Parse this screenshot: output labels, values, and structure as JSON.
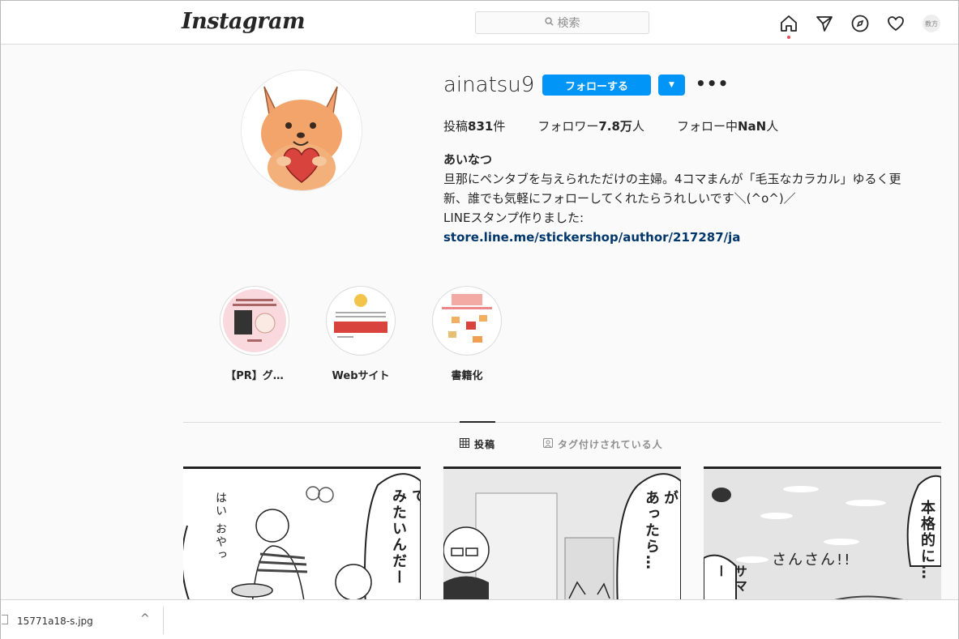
{
  "nav": {
    "logo": "Instagram",
    "search_placeholder": "検索",
    "avatar_text": "教方"
  },
  "profile": {
    "username": "ainatsu9",
    "follow_label": "フォローする",
    "more_label": "•••",
    "stats": {
      "posts_label": "投稿",
      "posts_value": "831",
      "posts_suffix": "件",
      "followers_label": "フォロワー",
      "followers_value": "7.8万",
      "followers_suffix": "人",
      "following_label": "フォロー中",
      "following_value": "NaN",
      "following_suffix": "人"
    },
    "display_name": "あいなつ",
    "bio_line1": "旦那にペンタブを与えられただけの主婦。4コマまんが「毛玉なカラカル」ゆるく更",
    "bio_line2": "新、誰でも気軽にフォローしてくれたらうれしいです＼(^o^)／",
    "bio_line3": "LINEスタンプ作りました:",
    "bio_link": "store.line.me/stickershop/author/217287/ja"
  },
  "highlights": [
    {
      "label": "【PR】グ…"
    },
    {
      "label": "Webサイト"
    },
    {
      "label": "書籍化"
    }
  ],
  "tabs": {
    "posts": "投稿",
    "tagged": "タグ付けされている人"
  },
  "posts": [
    {
      "text_a": "アルプスに行って",
      "text_b": "みたいんだー",
      "text_c": "はい おやっ"
    },
    {
      "text_a": "もしつらいことが",
      "text_b": "あったら…"
    },
    {
      "text_a": "本格的に…",
      "text_b": "さんさん!!",
      "text_c": "サマー"
    }
  ],
  "download": {
    "filename": "15771a18-s.jpg",
    "chevron": "^"
  },
  "colors": {
    "accent": "#0095f6",
    "link": "#00376b",
    "notification_dot": "#ed4956"
  }
}
